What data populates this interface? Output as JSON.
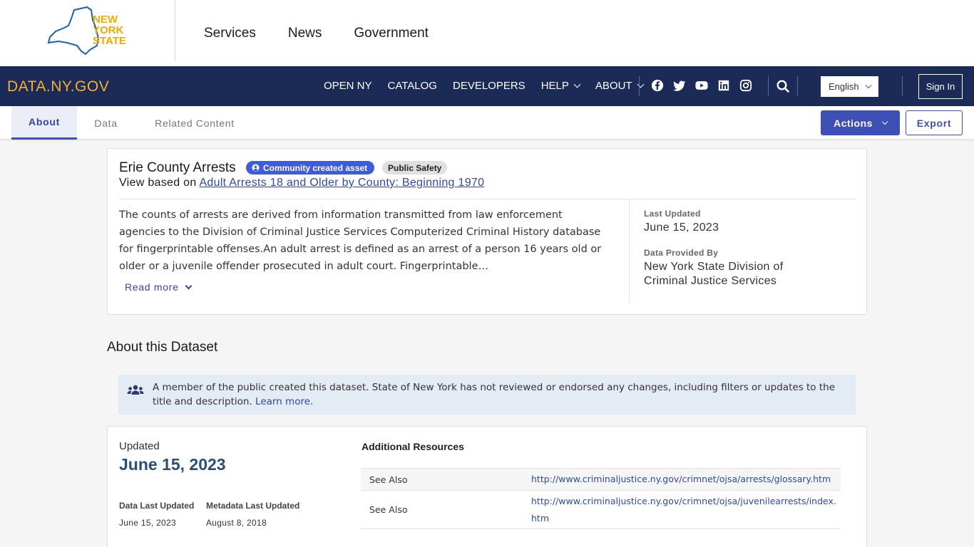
{
  "nys": {
    "logo_text": [
      "NEW",
      "YORK",
      "STATE"
    ],
    "nav": [
      "Services",
      "News",
      "Government"
    ]
  },
  "databar": {
    "site_name": "DATA.NY.GOV",
    "nav": [
      "OPEN NY",
      "CATALOG",
      "DEVELOPERS",
      "HELP",
      "ABOUT"
    ],
    "social_icons": [
      "facebook-icon",
      "twitter-icon",
      "youtube-icon",
      "linkedin-icon",
      "instagram-icon"
    ],
    "language": "English",
    "signin": "Sign In"
  },
  "tabs": {
    "about": "About",
    "data": "Data",
    "related": "Related Content",
    "actions": "Actions",
    "export": "Export"
  },
  "dataset": {
    "title": "Erie County Arrests",
    "community_badge": "Community created asset",
    "category": "Public Safety",
    "view_based_prefix": "View based on",
    "view_based_link": "Adult Arrests 18 and Older by County: Beginning 1970",
    "description": "The counts of arrests are derived from information transmitted from law enforcement agencies to the Division of Criminal Justice Services Computerized Criminal History database for fingerprintable offenses.An adult arrest is defined as an arrest of a person 16 years old or older or a juvenile offender prosecuted in adult court. Fingerprintable…",
    "read_more": "Read more",
    "last_updated_label": "Last Updated",
    "last_updated": "June 15, 2023",
    "provided_by_label": "Data Provided By",
    "provided_by_line1": "New York State Division of",
    "provided_by_line2": "Criminal Justice Services"
  },
  "about_section": {
    "title": "About this Dataset",
    "notice": "A member of the public created this dataset. State of New York has not reviewed or endorsed any changes, including filters or updates to the title and description.",
    "notice_link": "Learn more."
  },
  "details": {
    "updated_label": "Updated",
    "updated_value": "June 15, 2023",
    "data_last_updated_label": "Data Last Updated",
    "data_last_updated": "June 15, 2023",
    "metadata_last_updated_label": "Metadata Last Updated",
    "metadata_last_updated": "August 8, 2018",
    "resources_title": "Additional Resources",
    "resources": [
      {
        "key": "See Also",
        "value": "http://www.criminaljustice.ny.gov/crimnet/ojsa/arrests/glossary.htm"
      },
      {
        "key": "See Also",
        "value": "http://www.criminaljustice.ny.gov/crimnet/ojsa/juvenilearrests/index.htm"
      }
    ]
  },
  "colors": {
    "navy": "#1b2a57",
    "gold": "#f2b134",
    "accent": "#3e4fb5",
    "badge_blue": "#3e5bdb"
  }
}
